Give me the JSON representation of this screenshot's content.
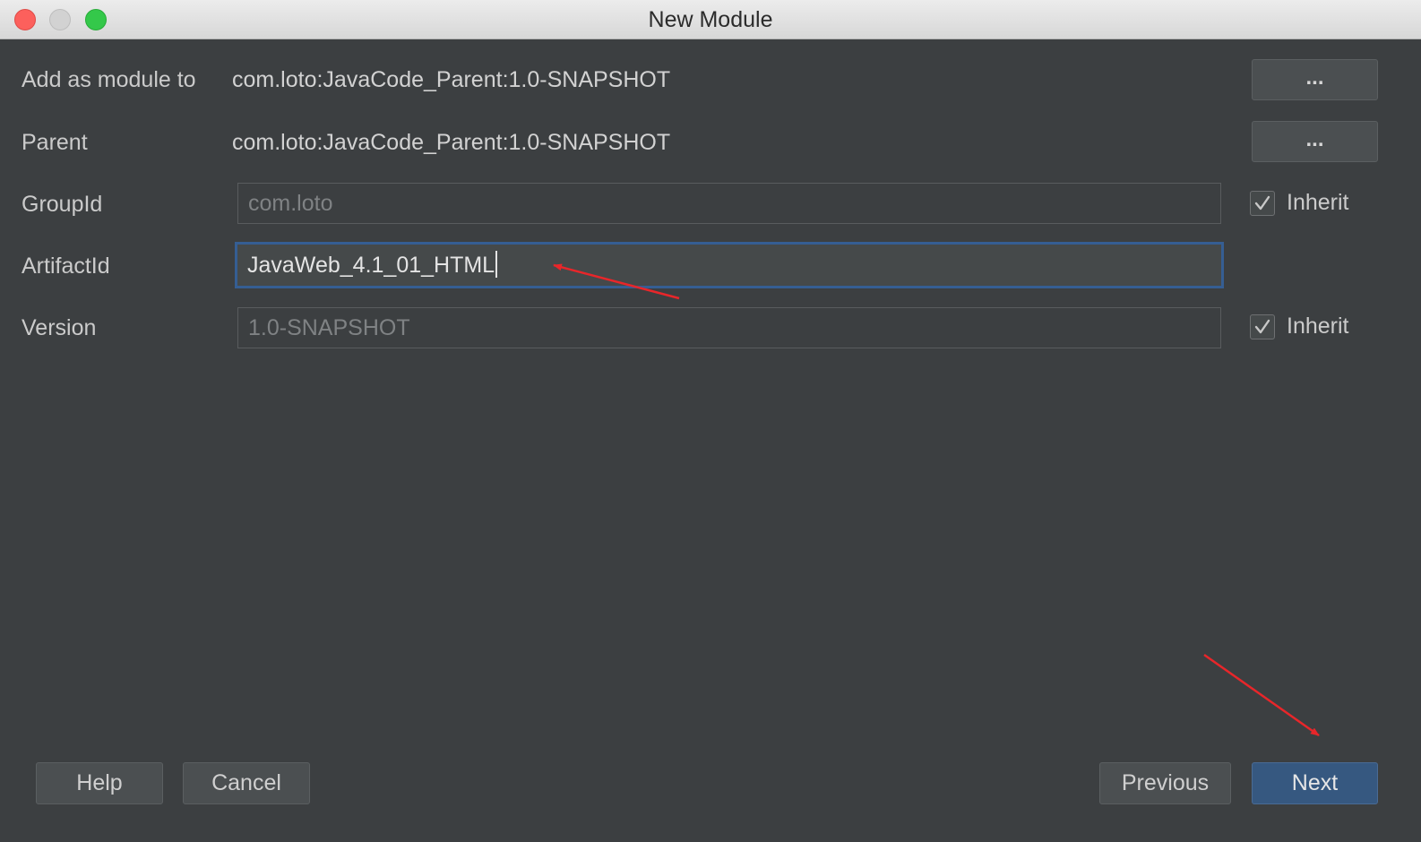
{
  "window": {
    "title": "New Module"
  },
  "form": {
    "add_as_module_label": "Add as module to",
    "add_as_module_value": "com.loto:JavaCode_Parent:1.0-SNAPSHOT",
    "parent_label": "Parent",
    "parent_value": "com.loto:JavaCode_Parent:1.0-SNAPSHOT",
    "browse_label": "...",
    "group_id_label": "GroupId",
    "group_id_value": "com.loto",
    "artifact_id_label": "ArtifactId",
    "artifact_id_value": "JavaWeb_4.1_01_HTML",
    "version_label": "Version",
    "version_value": "1.0-SNAPSHOT",
    "inherit_label": "Inherit"
  },
  "footer": {
    "help": "Help",
    "cancel": "Cancel",
    "previous": "Previous",
    "next": "Next"
  },
  "colors": {
    "background": "#3c3f41",
    "focus_border": "#355e93",
    "primary_button": "#365880",
    "annotation_arrow": "#e8262a"
  },
  "icons": {
    "checkmark": "check-icon",
    "arrows": "annotation-arrow-icon"
  }
}
